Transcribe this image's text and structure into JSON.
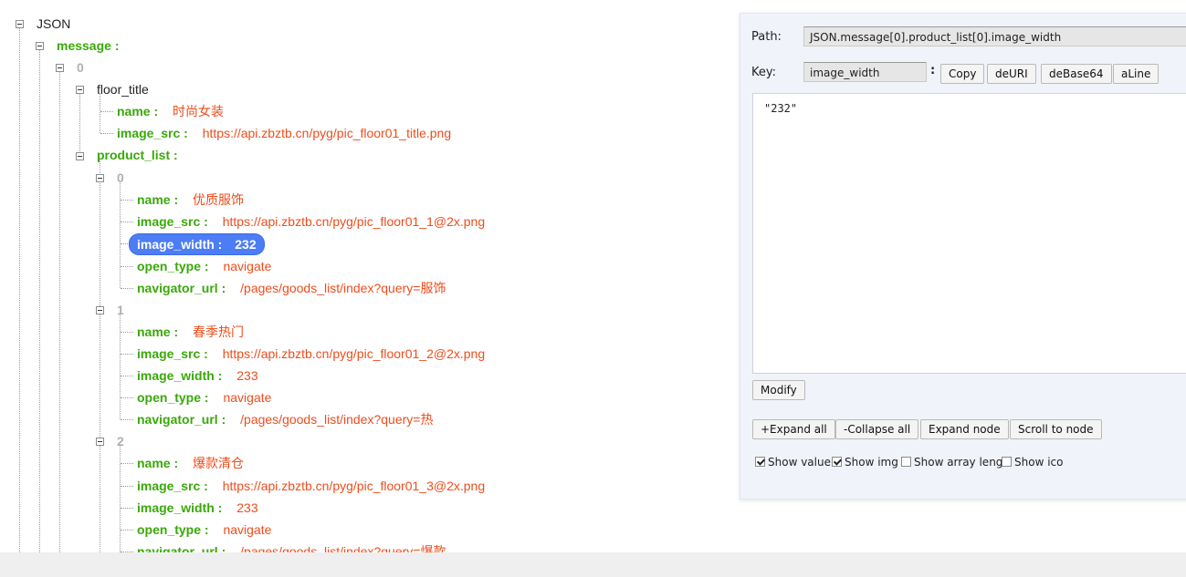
{
  "tree": {
    "root": "JSON",
    "message": "message :",
    "idx0": "0",
    "floor_title": "floor_title",
    "ft_name_key": "name :",
    "ft_name_val": "时尚女装",
    "ft_img_key": "image_src :",
    "ft_img_val": "https://api.zbztb.cn/pyg/pic_floor01_title.png",
    "product_list": "product_list :",
    "items": [
      {
        "index": "0",
        "name_key": "name :",
        "name_val": "优质服饰",
        "src_key": "image_src :",
        "src_val": "https://api.zbztb.cn/pyg/pic_floor01_1@2x.png",
        "width_key": "image_width :",
        "width_val": "232",
        "open_key": "open_type :",
        "open_val": "navigate",
        "nav_key": "navigator_url :",
        "nav_val": "/pages/goods_list/index?query=服饰"
      },
      {
        "index": "1",
        "name_key": "name :",
        "name_val": "春季热门",
        "src_key": "image_src :",
        "src_val": "https://api.zbztb.cn/pyg/pic_floor01_2@2x.png",
        "width_key": "image_width :",
        "width_val": "233",
        "open_key": "open_type :",
        "open_val": "navigate",
        "nav_key": "navigator_url :",
        "nav_val": "/pages/goods_list/index?query=热"
      },
      {
        "index": "2",
        "name_key": "name :",
        "name_val": "爆款清仓",
        "src_key": "image_src :",
        "src_val": "https://api.zbztb.cn/pyg/pic_floor01_3@2x.png",
        "width_key": "image_width :",
        "width_val": "233",
        "open_key": "open_type :",
        "open_val": "navigate",
        "nav_key": "navigator_url :",
        "nav_val": "/pages/goods_list/index?query=爆款"
      }
    ]
  },
  "panel": {
    "path_label": "Path:",
    "path_value": "JSON.message[0].product_list[0].image_width",
    "key_label": "Key:",
    "key_value": "image_width",
    "key_colon": ":",
    "copy": "Copy",
    "deuri": "deURI",
    "debase64": "deBase64",
    "aline": "aLine",
    "value_text": "\"232\"",
    "modify": "Modify",
    "expand_all": "+Expand all",
    "collapse_all": "-Collapse all",
    "expand_node": "Expand node",
    "scroll_to_node": "Scroll to node",
    "options": [
      {
        "label": "Show value",
        "checked": true
      },
      {
        "label": "Show img",
        "checked": true
      },
      {
        "label": "Show array leng",
        "checked": false
      },
      {
        "label": "Show ico",
        "checked": false
      }
    ]
  },
  "colors": {
    "key_green": "#3aa80a",
    "value_red": "#ee4d1c",
    "index_grey": "#b0b0b0",
    "selection_blue": "#4d7df4"
  }
}
